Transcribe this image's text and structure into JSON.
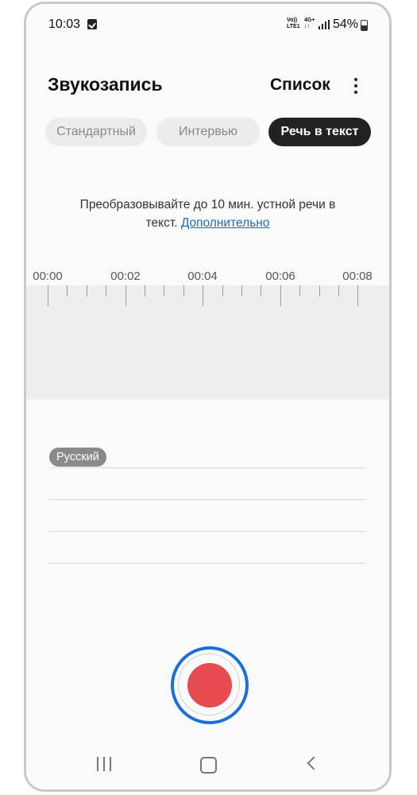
{
  "status": {
    "time": "10:03",
    "volte": "Vo)) LTE1",
    "network": "4G+",
    "battery": "54%"
  },
  "header": {
    "title": "Звукозапись",
    "list_label": "Список",
    "more_icon": "more-vert-icon"
  },
  "tabs": [
    {
      "label": "Стандартный",
      "selected": false
    },
    {
      "label": "Интервью",
      "selected": false
    },
    {
      "label": "Речь в текст",
      "selected": true
    }
  ],
  "info": {
    "text": "Преобразовывайте до 10 мин. устной речи в текст.",
    "text_line1": "Преобразовывайте до 10 мин. устной речи в",
    "text_line2": "текст.",
    "link": "Дополнительно"
  },
  "timeline": {
    "labels": [
      "00:00",
      "00:02",
      "00:04",
      "00:06",
      "00:08"
    ]
  },
  "transcript": {
    "language": "Русский"
  },
  "record": {
    "icon": "record-icon",
    "color": "#e84a4f",
    "focus_color": "#1a70d8"
  },
  "navbar": {
    "recents_icon": "recents-icon",
    "home_icon": "home-icon",
    "back_icon": "back-icon"
  }
}
